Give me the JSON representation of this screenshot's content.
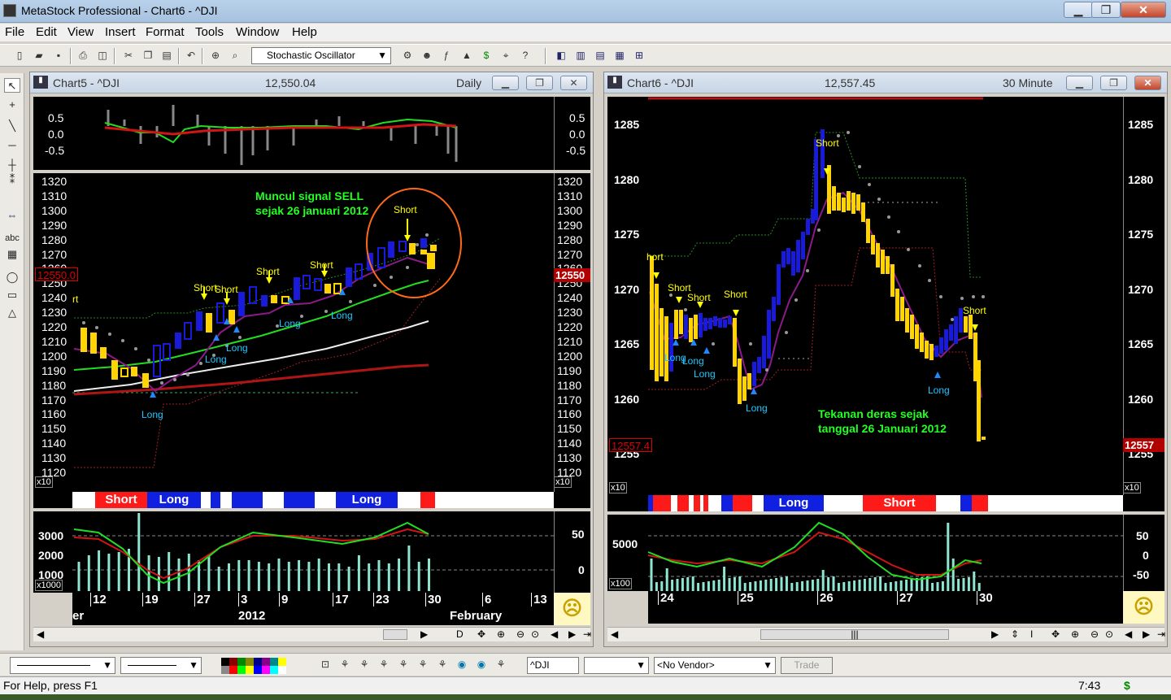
{
  "app": {
    "title": "MetaStock Professional - Chart6 - ^DJI",
    "window_buttons": {
      "min": "▁",
      "max": "❐",
      "close": "✕"
    }
  },
  "menu": [
    "File",
    "Edit",
    "View",
    "Insert",
    "Format",
    "Tools",
    "Window",
    "Help"
  ],
  "toolbar": {
    "indicator_combo": "Stochastic Oscillator"
  },
  "left_window": {
    "title": "Chart5 - ^DJI",
    "price": "12,550.04",
    "period": "Daily",
    "osc_ticks": [
      "0.5",
      "0.0",
      "-0.5"
    ],
    "price_ticks": [
      "1320",
      "1310",
      "1300",
      "1290",
      "1280",
      "1270",
      "1260",
      "1250",
      "1240",
      "1230",
      "1220",
      "1210",
      "1200",
      "1190",
      "1180",
      "1170",
      "1160",
      "1150",
      "1140",
      "1130",
      "1120"
    ],
    "scale_note": "x10",
    "last_price_label": "12550.0",
    "last_price_right": "12550",
    "annotation_line1": "Muncul signal SELL",
    "annotation_line2": "sejak 26 januari 2012",
    "signals": {
      "short_labels": [
        "Short",
        "Short",
        "Short",
        "Short",
        "Short",
        "Short"
      ],
      "long_labels": [
        "Long",
        "Long",
        "Long",
        "Long",
        "Long"
      ],
      "partial_label": "rt"
    },
    "bands": [
      "Short",
      "Long",
      "Long"
    ],
    "vol_ticks": [
      "3000",
      "2000",
      "1000"
    ],
    "vol_scale": "x1000",
    "vol_right_ticks": [
      "50",
      "0"
    ],
    "date_ticks": [
      "12",
      "19",
      "27",
      "3",
      "9",
      "17",
      "23",
      "30",
      "6",
      "13"
    ],
    "month_labels": [
      "er",
      "2012",
      "February"
    ]
  },
  "right_window": {
    "title": "Chart6 - ^DJI",
    "price": "12,557.45",
    "period": "30 Minute",
    "price_ticks": [
      "1285",
      "1280",
      "1275",
      "1270",
      "1265",
      "1260",
      "1255"
    ],
    "scale_note": "x10",
    "last_price_label": "12557.4",
    "last_price_right": "12557",
    "annotation_line1": "Tekanan deras sejak",
    "annotation_line2": "tanggal 26 Januari 2012",
    "signals": {
      "short_labels": [
        "Short",
        "Short",
        "Short",
        "Short",
        "Short",
        "Short"
      ],
      "long_labels": [
        "Long",
        "Long",
        "Long",
        "Long",
        "Long"
      ],
      "partial_label": "hort"
    },
    "bands": [
      "Long",
      "Short"
    ],
    "vol_ticks": [
      "5000"
    ],
    "vol_scale": "x100",
    "vol_right_ticks": [
      "50",
      "0",
      "-50"
    ],
    "date_ticks": [
      "24",
      "25",
      "26",
      "27",
      "30"
    ]
  },
  "bottom": {
    "symbol": "^DJI",
    "vendor": "<No Vendor>",
    "trade_button": "Trade"
  },
  "status": {
    "help": "For Help, press F1",
    "time": "7:43",
    "icon": "$"
  },
  "colors": {
    "candle_up": "#1a1adb",
    "candle_down": "#ffd400",
    "ma_green": "#22dd22",
    "ma_purple": "#8b1a8b",
    "ma_white": "#ffffff",
    "ma_red": "#b01515",
    "band_red": "#ff1a1a",
    "band_blue": "#1020e0",
    "circle": "#ff6a1a"
  }
}
